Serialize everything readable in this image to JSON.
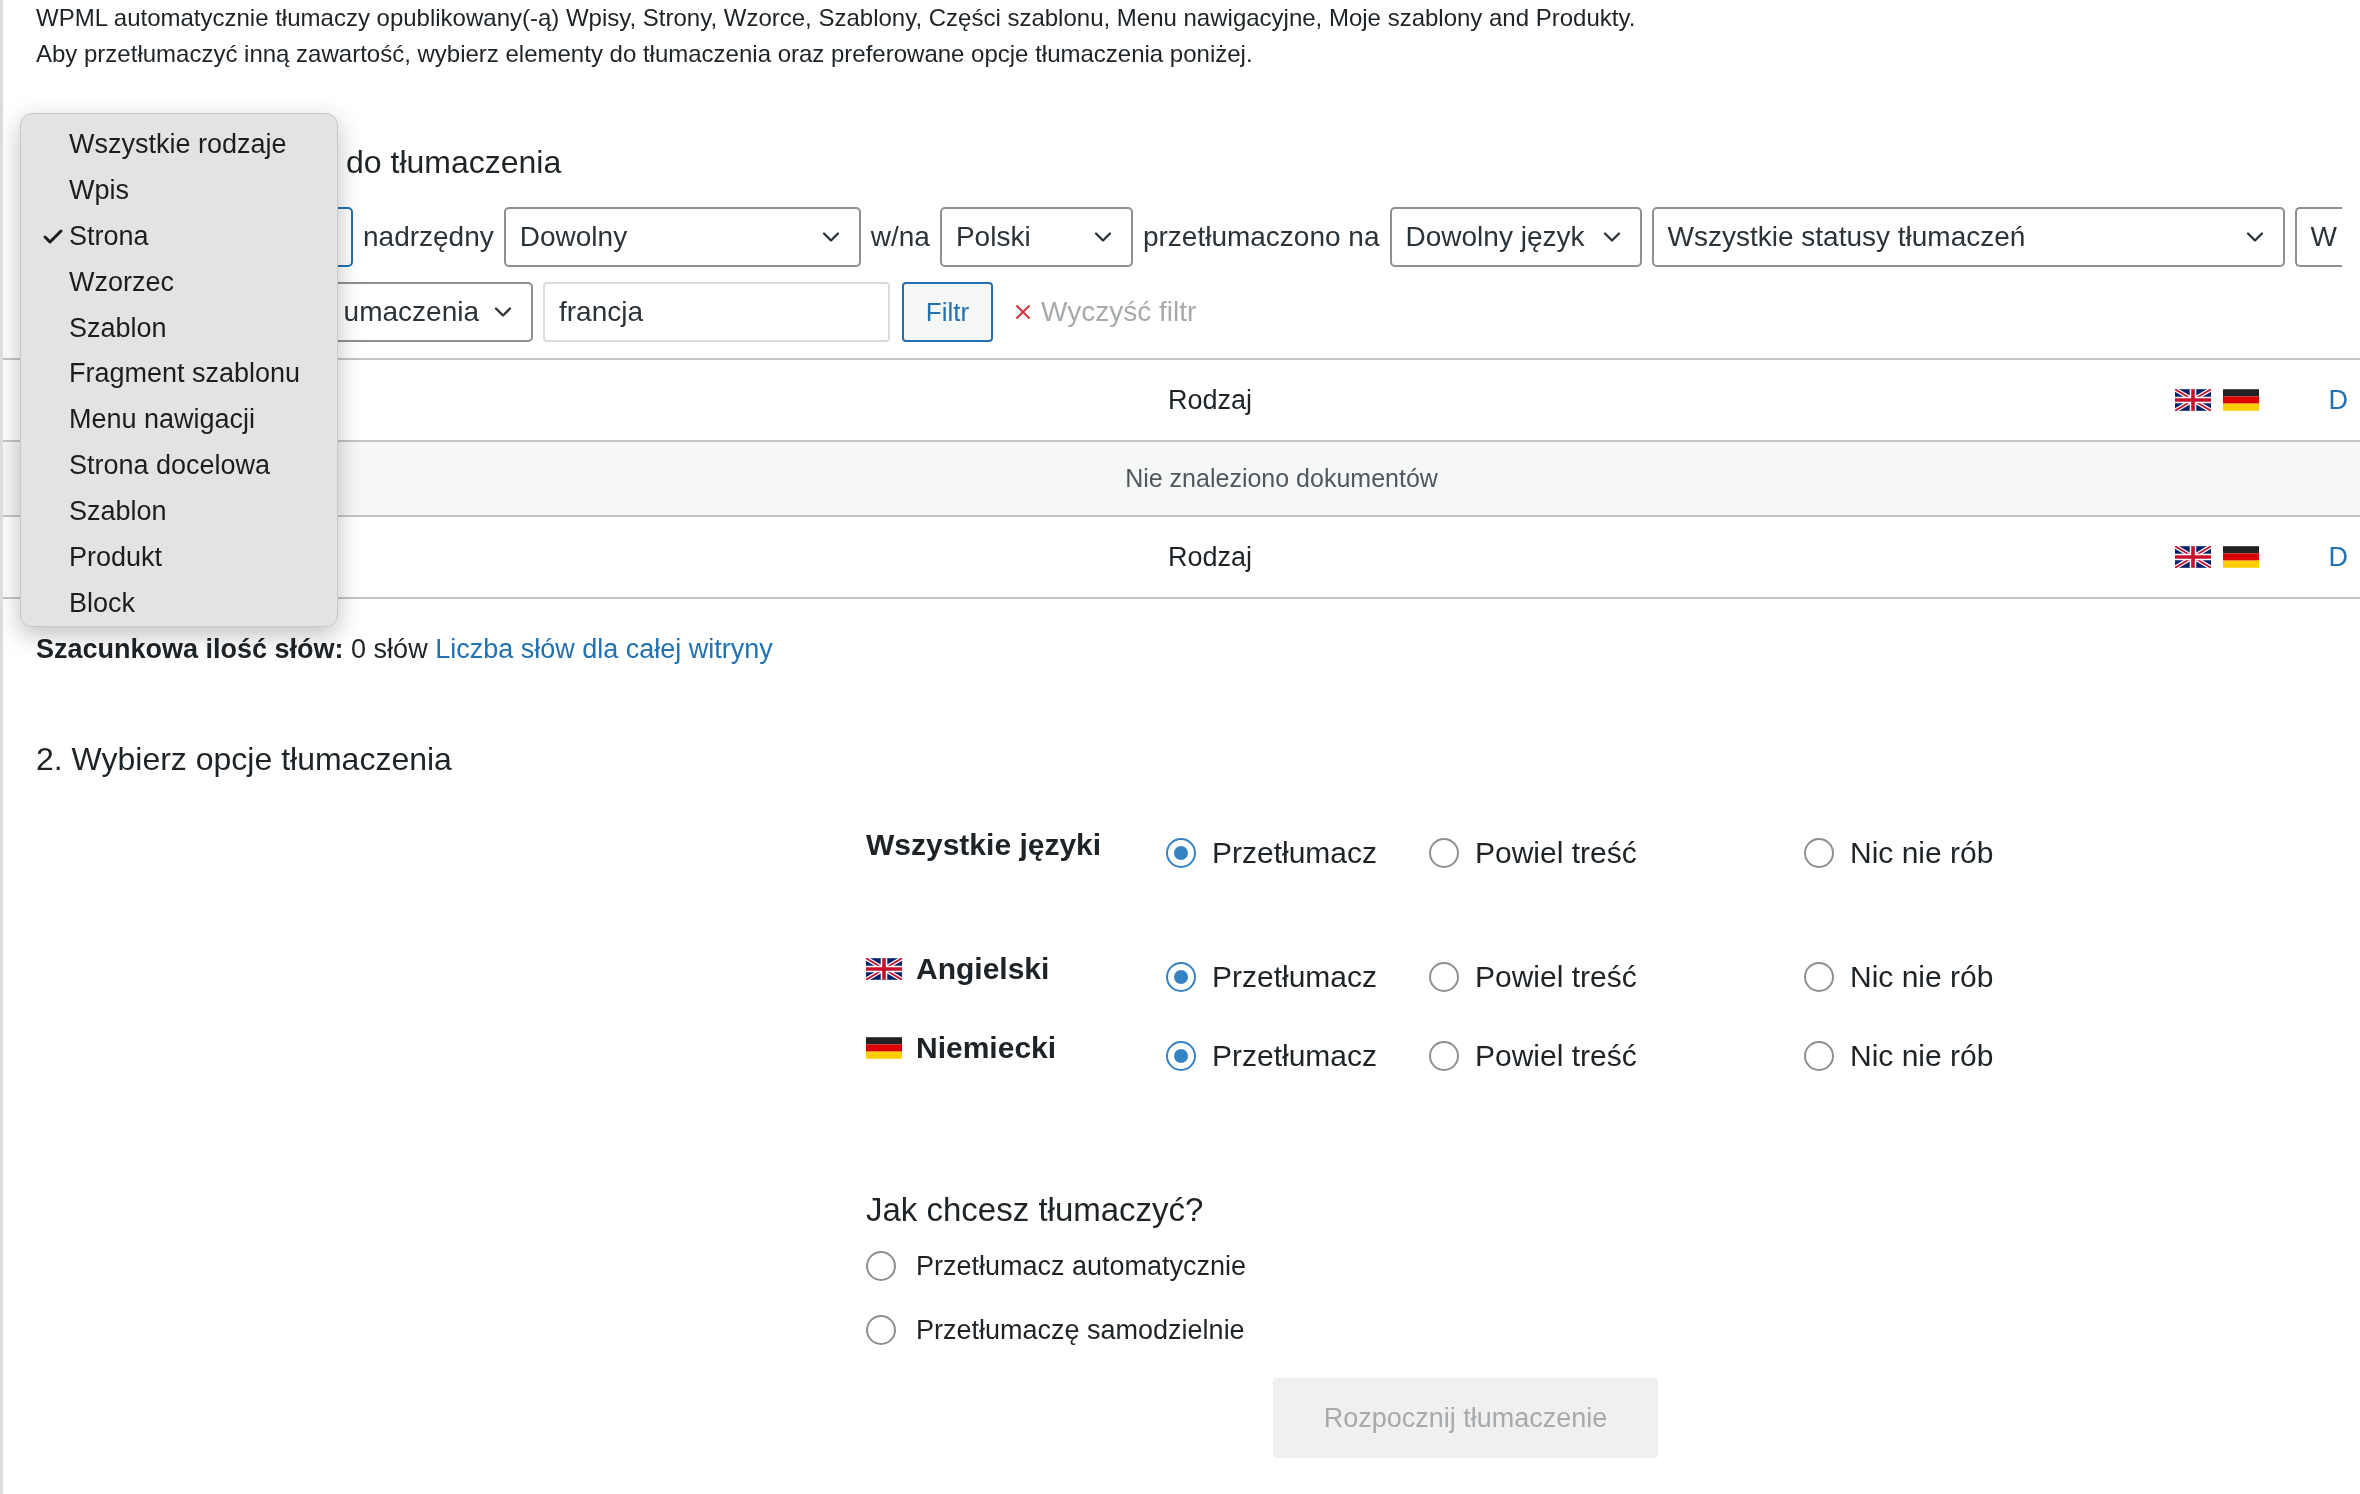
{
  "intro": [
    "WPML automatycznie tłumaczy opublikowany(-ą) Wpisy, Strony, Wzorce, Szablony, Części szablonu, Menu nawigacyjne, Moje szablony and Produkty.",
    "Aby przetłumaczyć inną zawartość, wybierz elementy do tłumaczenia oraz preferowane opcje tłumaczenia poniżej."
  ],
  "type_menu": [
    {
      "label": "Wszystkie rodzaje",
      "selected": false
    },
    {
      "label": "Wpis",
      "selected": false
    },
    {
      "label": "Strona",
      "selected": true
    },
    {
      "label": "Wzorzec",
      "selected": false
    },
    {
      "label": "Szablon",
      "selected": false
    },
    {
      "label": "Fragment szablonu",
      "selected": false
    },
    {
      "label": "Menu nawigacji",
      "selected": false
    },
    {
      "label": "Strona docelowa",
      "selected": false
    },
    {
      "label": "Szablon",
      "selected": false
    },
    {
      "label": "Produkt",
      "selected": false
    },
    {
      "label": "Block",
      "selected": false
    }
  ],
  "section1_title": "do tłumaczenia",
  "filter_row_1": [
    {
      "kind": "covered_select"
    },
    {
      "kind": "label",
      "text": "nadrzędny"
    },
    {
      "kind": "select",
      "value": "Dowolny"
    },
    {
      "kind": "label",
      "text": "w/na"
    },
    {
      "kind": "select",
      "value": "Polski"
    },
    {
      "kind": "label",
      "text": "przetłumaczono na"
    },
    {
      "kind": "select",
      "value": "Dowolny język"
    },
    {
      "kind": "select",
      "value": "Wszystkie statusy tłumaczeń"
    },
    {
      "kind": "cut_select",
      "value": "W"
    }
  ],
  "filter_row_2": [
    {
      "kind": "select",
      "value": "umaczenia"
    },
    {
      "kind": "input",
      "value": "francja"
    },
    {
      "kind": "button",
      "label": "Filtr"
    },
    {
      "kind": "clear",
      "label": "Wyczyść filtr"
    }
  ],
  "table": {
    "header": {
      "type_label": "Rodzaj",
      "flags": [
        {
          "kind": "uk"
        },
        {
          "kind": "de"
        }
      ],
      "link": "D"
    },
    "empty_message": "Nie znaleziono dokumentów",
    "footer": {
      "type_label": "Rodzaj",
      "flags": [
        {
          "kind": "uk"
        },
        {
          "kind": "de"
        }
      ],
      "link": "D"
    }
  },
  "word_count": {
    "text": "**Szacunkowa ilość słów:** 0 słów",
    "link": "Liczba słów dla całej witryny"
  },
  "section2": {
    "title": "2. Wybierz opcje tłumaczenia",
    "rows": [
      {
        "kind": "all",
        "label": "Wszystkie języki",
        "choices": [
          {
            "label": "Przetłumacz",
            "selected": true
          },
          {
            "label": "Powiel treść",
            "selected": false
          },
          {
            "label": "Nic nie rób",
            "selected": false
          }
        ]
      },
      {
        "kind": "language",
        "flag": {
          "kind": "uk"
        },
        "label": "Angielski",
        "choices": [
          {
            "label": "Przetłumacz",
            "selected": true
          },
          {
            "label": "Powiel treść",
            "selected": false
          },
          {
            "label": "Nic nie rób",
            "selected": false
          }
        ]
      },
      {
        "kind": "language",
        "flag": {
          "kind": "de"
        },
        "label": "Niemiecki",
        "choices": [
          {
            "label": "Przetłumacz",
            "selected": true
          },
          {
            "label": "Powiel treść",
            "selected": false
          },
          {
            "label": "Nic nie rób",
            "selected": false
          }
        ]
      }
    ]
  },
  "method": {
    "title": "Jak chcesz tłumaczyć?",
    "choices": [
      {
        "label": "Przetłumacz automatycznie",
        "selected": false
      },
      {
        "label": "Przetłumaczę samodzielnie",
        "selected": false
      }
    ]
  },
  "start_button": {
    "label": "Rozpocznij tłumaczenie",
    "disabled": true
  }
}
